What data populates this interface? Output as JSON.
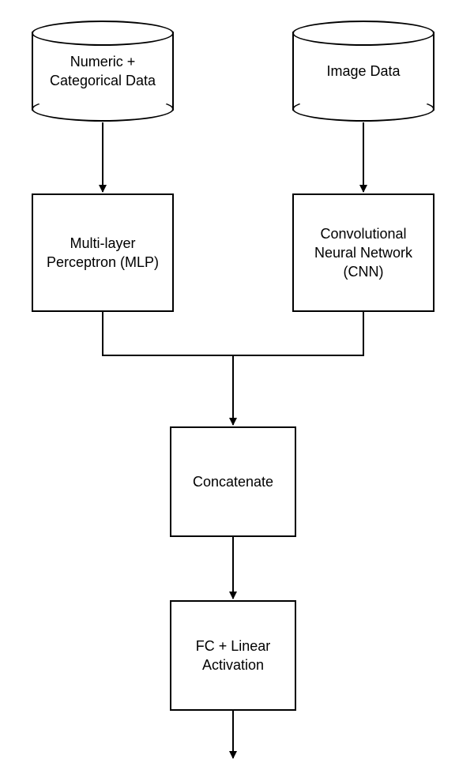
{
  "nodes": {
    "data_left": "Numeric + Categorical Data",
    "data_right": "Image Data",
    "model_left": "Multi-layer Perceptron (MLP)",
    "model_right": "Convolutional Neural Network (CNN)",
    "concat": "Concatenate",
    "output": "FC + Linear Activation"
  },
  "flow": [
    {
      "from": "data_left",
      "to": "model_left"
    },
    {
      "from": "data_right",
      "to": "model_right"
    },
    {
      "from": "model_left",
      "to": "concat",
      "join": true
    },
    {
      "from": "model_right",
      "to": "concat",
      "join": true
    },
    {
      "from": "concat",
      "to": "output"
    },
    {
      "from": "output",
      "to": "end"
    }
  ]
}
